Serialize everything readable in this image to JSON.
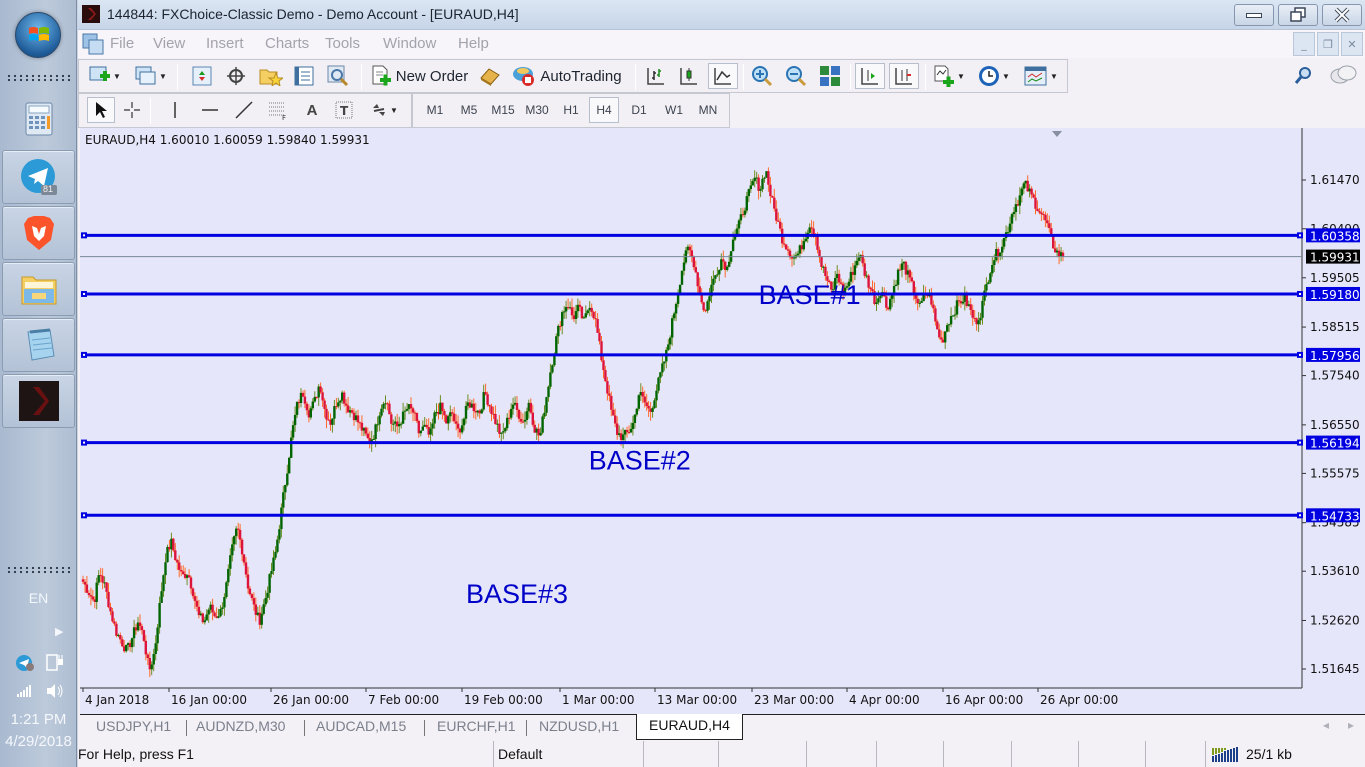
{
  "taskbar": {
    "apps": [
      {
        "name": "calculator",
        "badge": null
      },
      {
        "name": "telegram",
        "badge": "81"
      },
      {
        "name": "brave-browser",
        "badge": null
      },
      {
        "name": "file-explorer",
        "badge": null
      },
      {
        "name": "notepad",
        "badge": null
      },
      {
        "name": "metatrader",
        "badge": null
      }
    ],
    "language": "EN",
    "time": "1:21 PM",
    "date": "4/29/2018"
  },
  "window": {
    "title": "144844: FXChoice-Classic Demo - Demo Account - [EURAUD,H4]"
  },
  "menu": [
    "File",
    "View",
    "Insert",
    "Charts",
    "Tools",
    "Window",
    "Help"
  ],
  "toolbar": {
    "new_order": "New Order",
    "autotrading": "AutoTrading",
    "timeframes": [
      "M1",
      "M5",
      "M15",
      "M30",
      "H1",
      "H4",
      "D1",
      "W1",
      "MN"
    ],
    "active_timeframe": "H4"
  },
  "chart": {
    "header": "EURAUD,H4  1.60010 1.60059 1.59840 1.59931",
    "colors": {
      "background": "#e6e6fa",
      "bull": "#006400",
      "bear": "#dc143c",
      "level_line": "#0000e0",
      "bid_line": "#778899"
    }
  },
  "chart_data": {
    "type": "candlestick",
    "symbol": "EURAUD",
    "timeframe": "H4",
    "ohlc_last": {
      "open": 1.6001,
      "high": 1.60059,
      "low": 1.5984,
      "close": 1.59931
    },
    "ylim": [
      1.5127,
      1.623
    ],
    "y_ticks": [
      "1.61470",
      "1.60490",
      "1.59505",
      "1.58515",
      "1.57540",
      "1.56550",
      "1.55575",
      "1.54585",
      "1.53610",
      "1.52620",
      "1.51645"
    ],
    "x_ticks": [
      "4 Jan 2018",
      "16 Jan 00:00",
      "26 Jan 00:00",
      "7 Feb 00:00",
      "19 Feb 00:00",
      "1 Mar 00:00",
      "13 Mar 00:00",
      "23 Mar 00:00",
      "4 Apr 00:00",
      "16 Apr 00:00",
      "26 Apr 00:00"
    ],
    "bid": {
      "value": 1.59931,
      "label": "1.59931"
    },
    "levels": [
      {
        "value": 1.60358,
        "label": "1.60358"
      },
      {
        "value": 1.5918,
        "label": "1.59180"
      },
      {
        "value": 1.57956,
        "label": "1.57956"
      },
      {
        "value": 1.56194,
        "label": "1.56194"
      },
      {
        "value": 1.54733,
        "label": "1.54733"
      }
    ],
    "annotations": [
      {
        "text": "BASE#1",
        "price": 1.5918,
        "bar_fraction": 0.688
      },
      {
        "text": "BASE#2",
        "price": 1.5585,
        "bar_fraction": 0.515
      },
      {
        "text": "BASE#3",
        "price": 1.5317,
        "bar_fraction": 0.39
      }
    ],
    "price_path": [
      1.534,
      1.532,
      1.53,
      1.536,
      1.533,
      1.528,
      1.524,
      1.522,
      1.52,
      1.523,
      1.526,
      1.523,
      1.516,
      1.52,
      1.53,
      1.539,
      1.542,
      1.538,
      1.535,
      1.536,
      1.532,
      1.527,
      1.526,
      1.529,
      1.527,
      1.528,
      1.533,
      1.54,
      1.545,
      1.54,
      1.533,
      1.529,
      1.526,
      1.53,
      1.535,
      1.54,
      1.548,
      1.556,
      1.564,
      1.57,
      1.572,
      1.568,
      1.57,
      1.574,
      1.568,
      1.566,
      1.57,
      1.572,
      1.569,
      1.568,
      1.566,
      1.564,
      1.562,
      1.564,
      1.569,
      1.571,
      1.566,
      1.565,
      1.567,
      1.569,
      1.568,
      1.564,
      1.565,
      1.563,
      1.568,
      1.569,
      1.566,
      1.568,
      1.564,
      1.566,
      1.57,
      1.569,
      1.568,
      1.572,
      1.569,
      1.566,
      1.563,
      1.566,
      1.57,
      1.568,
      1.566,
      1.57,
      1.565,
      1.563,
      1.57,
      1.577,
      1.583,
      1.588,
      1.59,
      1.587,
      1.589,
      1.586,
      1.59,
      1.587,
      1.58,
      1.574,
      1.568,
      1.564,
      1.563,
      1.564,
      1.566,
      1.572,
      1.57,
      1.568,
      1.572,
      1.576,
      1.58,
      1.586,
      1.592,
      1.598,
      1.601,
      1.598,
      1.592,
      1.588,
      1.593,
      1.596,
      1.599,
      1.597,
      1.603,
      1.605,
      1.609,
      1.612,
      1.615,
      1.613,
      1.617,
      1.611,
      1.607,
      1.603,
      1.601,
      1.599,
      1.6,
      1.603,
      1.606,
      1.604,
      1.598,
      1.595,
      1.592,
      1.596,
      1.592,
      1.594,
      1.597,
      1.6,
      1.596,
      1.593,
      1.59,
      1.593,
      1.589,
      1.592,
      1.596,
      1.598,
      1.595,
      1.592,
      1.589,
      1.592,
      1.591,
      1.585,
      1.582,
      1.586,
      1.588,
      1.59,
      1.591,
      1.589,
      1.586,
      1.588,
      1.593,
      1.598,
      1.6,
      1.602,
      1.605,
      1.609,
      1.611,
      1.614,
      1.612,
      1.61,
      1.608,
      1.606,
      1.602,
      1.6,
      1.5993
    ]
  },
  "tabs": [
    "USDJPY,H1",
    "AUDNZD,M30",
    "AUDCAD,M15",
    "EURCHF,H1",
    "NZDUSD,H1",
    "EURAUD,H4"
  ],
  "active_tab": "EURAUD,H4",
  "status": {
    "help": "For Help, press F1",
    "profile": "Default",
    "traffic": "25/1 kb"
  }
}
